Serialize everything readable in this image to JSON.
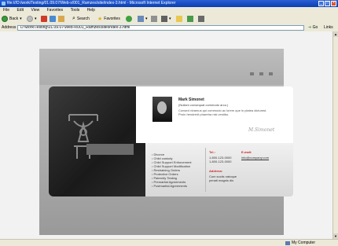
{
  "window": {
    "title": "file:///D:/work/Testing/01.09.07/Web-x/001_Ramzes/site/index-3.html - Microsoft Internet Explorer"
  },
  "menu": [
    "File",
    "Edit",
    "View",
    "Favorites",
    "Tools",
    "Help"
  ],
  "toolbar": {
    "back": "Back",
    "search": "Search",
    "favorites": "Favorites"
  },
  "address": {
    "label": "Address",
    "value": "D:\\work\\Testing\\01.09.07\\Web-x\\001_Ramzes\\site\\index-3.html",
    "go": "Go",
    "links": "Links"
  },
  "profile": {
    "name": "Mark Simonet",
    "subtitle": "(Nullam consequat commodo arcu.)",
    "text": [
      "Consed vivamus qui commodo ac lorem que in platea dictumst.",
      "Proin hendrerit pharetra nisi vestibu."
    ],
    "signature": "M.Simonet"
  },
  "services": [
    "Divorce",
    "Child custody",
    "Child Support Enforcement",
    "Child Support Modification",
    "Restraining Orders",
    "Protective Orders",
    "Paternity Testing",
    "Premarital Agreements",
    "Postmarital Agreements"
  ],
  "contacts": {
    "tel_label": "Tel.:",
    "tel": [
      "1-800-123-0000",
      "1-800-123-0000"
    ],
    "email_label": "E-mail:",
    "email": "info@company.com",
    "address_label": "Address:",
    "address": [
      "Cum sociis natoque",
      "penati magnis dis"
    ]
  },
  "status": {
    "zone": "My Computer"
  },
  "colors": {
    "accent": "#cc2222",
    "titlebar": "#0a3fb0"
  }
}
